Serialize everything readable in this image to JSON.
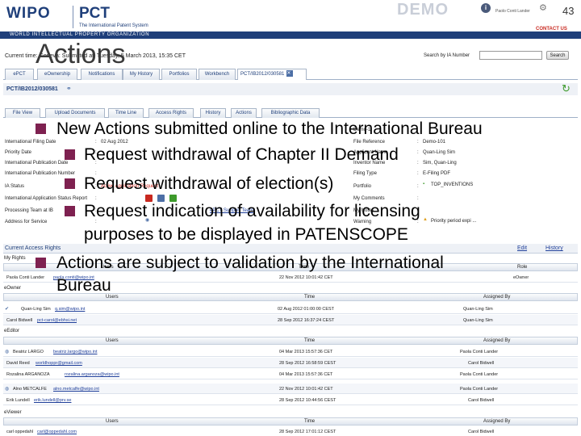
{
  "header": {
    "wipo_logo": "WIPO",
    "pct_logo": "PCT",
    "pct_sub": "The International Patent System",
    "org_name": "WORLD INTELLECTUAL PROPERTY ORGANIZATION",
    "demo_badge": "DEMO",
    "user_info": "Paolo Conti Lander",
    "page_number": "43",
    "contact_us": "CONTACT US",
    "info_icon": "info-icon",
    "gear_icon": "gear-icon"
  },
  "welcome": {
    "time_text": "Current time: Geneva: Submitted at: Tuesday, 5 March 2013, 15:35 CET",
    "search_label": "Search by IA Number",
    "search_button": "Search"
  },
  "top_tabs": [
    "ePCT",
    "eOwnership",
    "Notifications",
    "My History",
    "Portfolios",
    "Workbench",
    "PCT/IB2012/030581"
  ],
  "case": {
    "title": "PCT/IB2012/030581"
  },
  "sub_tabs": [
    "File View",
    "Upload Documents",
    "Time Line",
    "Access Rights",
    "History",
    "Actions",
    "Bibliographic Data"
  ],
  "details_left": [
    {
      "label": "International Filing Date",
      "value": "02 Aug 2012"
    },
    {
      "label": "Priority Date",
      "value": ""
    },
    {
      "label": "International Publication Date",
      "value": ""
    },
    {
      "label": "International Publication Number",
      "value": ""
    },
    {
      "label": "IA Status",
      "value": "Active Application Request"
    },
    {
      "label": "International Application Status Report",
      "value": ""
    },
    {
      "label": "Processing Team at IB",
      "value": "ePCT Support Team"
    },
    {
      "label": "Address for Service",
      "value": ""
    }
  ],
  "details_right": [
    {
      "label": "Demo-1",
      "value": ""
    },
    {
      "label": "File Reference",
      "value": "Demo-101"
    },
    {
      "label": "Applicant Name",
      "value": "Quan-Ling Sim"
    },
    {
      "label": "Inventor Name",
      "value": "Sim, Quan-Ling"
    },
    {
      "label": "Filing Type",
      "value": "E-Filing PDF"
    },
    {
      "label": "Portfolio",
      "value": "TOP_INVENTIONS"
    },
    {
      "label": "My Comments",
      "value": ""
    },
    {
      "label": "My Notes",
      "value": ""
    },
    {
      "label": "Warning",
      "value": "Priority period expi ..."
    }
  ],
  "access": {
    "section_title": "Current Access Rights",
    "edit_link": "Edit",
    "history_link": "History",
    "my_rights_label": "My Rights",
    "col_users": "Users",
    "col_time": "Time",
    "col_assigned": "Assigned By",
    "col_role": "Role",
    "my_rights_row": {
      "user": "Paola Conti Lander",
      "email": "paola.conti@wipo.int",
      "time": "22 Nov 2012 10:01:42 CET",
      "assigned": "",
      "role": "eOwner"
    },
    "groups": [
      {
        "name": "eOwner",
        "rows": [
          {
            "user": "Quan-Ling Sim",
            "email": "q.sim@wipo.int",
            "time": "02 Aug 2012 01:00:00 CEST",
            "assigned": "Quan-Ling Sim"
          },
          {
            "user": "Carol Bidwell",
            "email": "pct-carol@ebhsi.net",
            "time": "28 Sep 2012 16:37:24 CEST",
            "assigned": "Quan-Ling Sim"
          }
        ]
      },
      {
        "name": "eEditor",
        "rows": [
          {
            "user": "Beatriz LARGO",
            "email": "beatriz.largo@wipo.int",
            "time": "04 Mar 2013 15:57:36 CET",
            "assigned": "Paola Conti Lander"
          },
          {
            "user": "David Reed",
            "email": "worldhoppr@gmail.com",
            "time": "28 Sep 2012 16:58:59 CEST",
            "assigned": "Carol Bidwell"
          },
          {
            "user": "Rozalina ARGANOZA",
            "email": "rozalina.arganoza@wipo.int",
            "time": "04 Mar 2013 15:57:36 CET",
            "assigned": "Paola Conti Lander"
          },
          {
            "user": "Alno METCALFE",
            "email": "alno.metcalfe@wipo.int",
            "time": "22 Nov 2012 10:01:42 CET",
            "assigned": "Paola Conti Lander"
          },
          {
            "user": "Erik Lundell",
            "email": "erik.lundell@prv.se",
            "time": "28 Sep 2012 10:44:56 CEST",
            "assigned": "Carol Bidwell"
          }
        ]
      },
      {
        "name": "eViewer",
        "rows": [
          {
            "user": "carl oppedahl",
            "email": "carl@oppedahl.com",
            "time": "28 Sep 2012 17:01:12 CEST",
            "assigned": "Carol Bidwell"
          }
        ]
      }
    ]
  },
  "slide": {
    "title": "Actions",
    "bullets": [
      {
        "level": 1,
        "text": "New Actions submitted online to the International Bureau"
      },
      {
        "level": 2,
        "text": "Request withdrawal of Chapter II Demand"
      },
      {
        "level": 2,
        "text": "Request withdrawal of election(s)"
      },
      {
        "level": 2,
        "text": "Request indication of availability for licensing"
      },
      {
        "level": 2,
        "text": "purposes to be displayed in PATENSCOPE"
      },
      {
        "level": 1,
        "text": "Actions are subject to validation by the International"
      },
      {
        "level": 1,
        "text": "Bureau"
      }
    ],
    "bullet_color": "#7e2150"
  },
  "colors": {
    "brand_navy": "#1f3f7a",
    "contact_red": "#c8281f",
    "link_blue": "#1f3f9a"
  }
}
